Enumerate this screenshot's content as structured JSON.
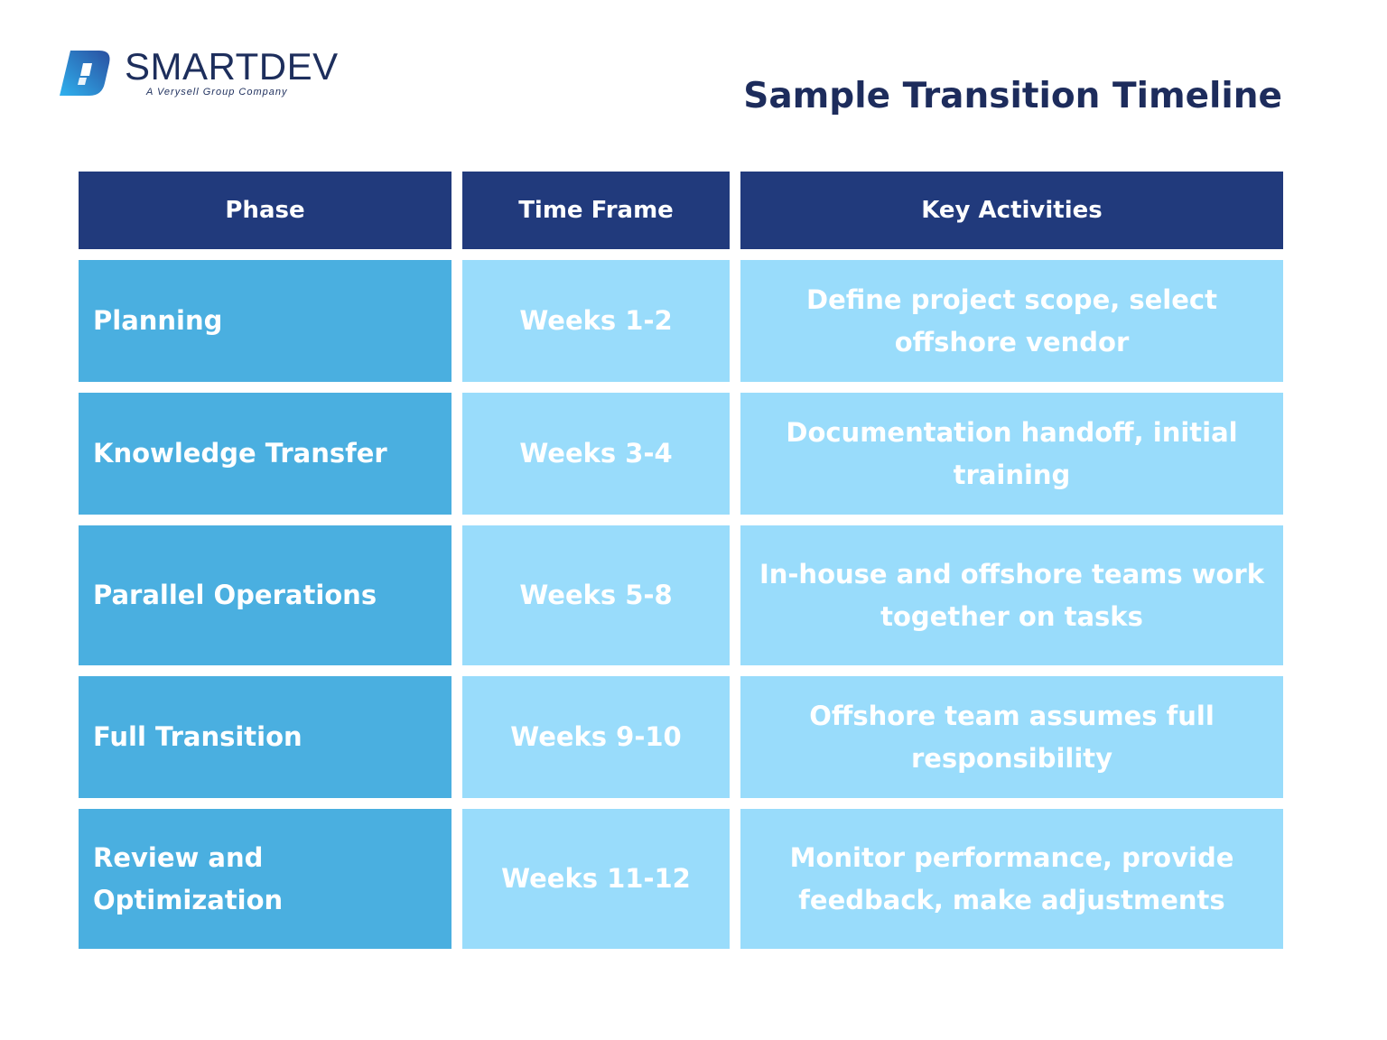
{
  "brand": {
    "name": "SMARTDEV",
    "tagline": "A Verysell Group Company",
    "colors": {
      "navy": "#1d2c5c",
      "header": "#213a7c",
      "phase": "#4aafe0",
      "light": "#99dcfb"
    }
  },
  "title": "Sample Transition Timeline",
  "table": {
    "headers": [
      "Phase",
      "Time Frame",
      "Key Activities"
    ],
    "rows": [
      {
        "phase": "Planning",
        "time": "Weeks 1-2",
        "activities": "Define project scope, select offshore vendor"
      },
      {
        "phase": "Knowledge Transfer",
        "time": "Weeks 3-4",
        "activities": "Documentation handoff, initial training"
      },
      {
        "phase": "Parallel Operations",
        "time": "Weeks 5-8",
        "activities": "In-house and offshore teams work together on tasks"
      },
      {
        "phase": "Full Transition",
        "time": "Weeks 9-10",
        "activities": "Offshore team assumes full responsibility"
      },
      {
        "phase": "Review and Optimization",
        "time": "Weeks 11-12",
        "activities": "Monitor performance, provide feedback, make adjustments"
      }
    ]
  }
}
